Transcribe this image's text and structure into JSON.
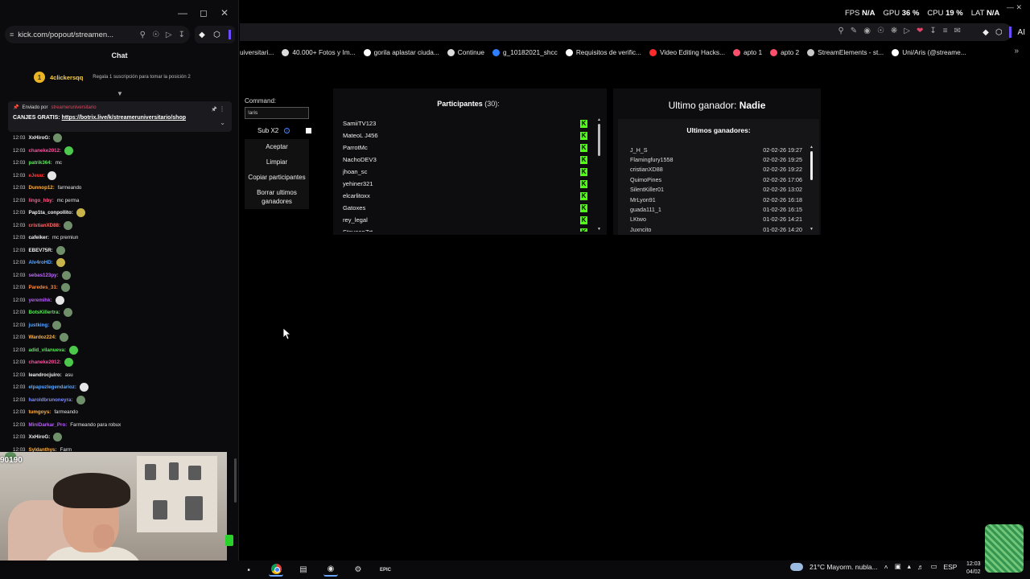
{
  "chat_window": {
    "url": "kick.com/popout/streamen...",
    "title": "Chat",
    "top_supporter": {
      "rank": "1",
      "name": "4clickersqq",
      "text": "Regala 1 suscripción para tomar la posición 2"
    },
    "pinned": {
      "sent_by_label": "Enviado por",
      "sender": "streameruniversitario",
      "text_label": "CANJES GRATIS:",
      "link": "https://botrix.live/k/streameruniversitario/shop"
    },
    "messages": [
      {
        "time": "12:03",
        "user": "XxHiroG:",
        "color": "#f2f2f2",
        "text": "",
        "emote": "frog"
      },
      {
        "time": "12:03",
        "user": "chaneke2012:",
        "color": "#ff4fa0",
        "text": "",
        "emote": "green"
      },
      {
        "time": "12:03",
        "user": "patrik364:",
        "color": "#5ce65c",
        "text": "mc",
        "emote": ""
      },
      {
        "time": "12:03",
        "user": "eJeuu:",
        "color": "#ff3b3b",
        "text": "",
        "emote": "white"
      },
      {
        "time": "12:03",
        "user": "Dunnop12:",
        "color": "#ffb347",
        "text": "farmeando",
        "emote": ""
      },
      {
        "time": "12:03",
        "user": "lingo_hby:",
        "color": "#ff5a8a",
        "text": "mc perma",
        "emote": ""
      },
      {
        "time": "12:03",
        "user": "Pap1ta_conpollito:",
        "color": "#f2f2f2",
        "text": "",
        "emote": "yellow"
      },
      {
        "time": "12:03",
        "user": "cristianXD88:",
        "color": "#ff6a6a",
        "text": "",
        "emote": "frog"
      },
      {
        "time": "12:03",
        "user": "cafeiker:",
        "color": "#f2f2f2",
        "text": "mc premiun",
        "emote": ""
      },
      {
        "time": "12:03",
        "user": "EBEV75R:",
        "color": "#f2f2f2",
        "text": "",
        "emote": "frog"
      },
      {
        "time": "12:03",
        "user": "Alv4roHD:",
        "color": "#5da8ff",
        "text": "",
        "emote": "yellow"
      },
      {
        "time": "12:03",
        "user": "sebas123py:",
        "color": "#c06bff",
        "text": "",
        "emote": "frog"
      },
      {
        "time": "12:03",
        "user": "Paredes_31:",
        "color": "#ff8a3d",
        "text": "",
        "emote": "frog"
      },
      {
        "time": "12:03",
        "user": "yeremihk:",
        "color": "#b95cff",
        "text": "",
        "emote": "white"
      },
      {
        "time": "12:03",
        "user": "BotsKillertra:",
        "color": "#5ce65c",
        "text": "",
        "emote": "frog"
      },
      {
        "time": "12:03",
        "user": "justking:",
        "color": "#5da8ff",
        "text": "",
        "emote": "frog"
      },
      {
        "time": "12:03",
        "user": "Wardoz224:",
        "color": "#ffb347",
        "text": "",
        "emote": "frog"
      },
      {
        "time": "12:03",
        "user": "adid_vilanueva:",
        "color": "#5ce65c",
        "text": "",
        "emote": "green"
      },
      {
        "time": "12:03",
        "user": "chaneke2012:",
        "color": "#ff4fa0",
        "text": "",
        "emote": "green"
      },
      {
        "time": "12:03",
        "user": "leandrocjuiro:",
        "color": "#f2f2f2",
        "text": "asu",
        "emote": ""
      },
      {
        "time": "12:03",
        "user": "elpapuzlegendarioz:",
        "color": "#5da8ff",
        "text": "",
        "emote": "white"
      },
      {
        "time": "12:03",
        "user": "haroldbrunoneyra:",
        "color": "#7b8cff",
        "text": "",
        "emote": "frog"
      },
      {
        "time": "12:03",
        "user": "tumgoys:",
        "color": "#ffb347",
        "text": "farmeando",
        "emote": ""
      },
      {
        "time": "12:03",
        "user": "MiniDarkar_Pro:",
        "color": "#b95cff",
        "text": "Farmeando para robux",
        "emote": ""
      },
      {
        "time": "12:03",
        "user": "XxHiroG:",
        "color": "#f2f2f2",
        "text": "",
        "emote": "frog"
      },
      {
        "time": "12:03",
        "user": "Syldanthys:",
        "color": "#ffb347",
        "text": "Farm",
        "emote": ""
      }
    ],
    "cam_badge": "90190"
  },
  "system_stats": {
    "fps_label": "FPS",
    "fps": "N/A",
    "gpu_label": "GPU",
    "gpu": "36 %",
    "cpu_label": "CPU",
    "cpu": "19 %",
    "lat_label": "LAT",
    "lat": "N/A"
  },
  "browser": {
    "url_fragment": "uiversitari...",
    "bookmarks": [
      {
        "label": "40.000+ Fotos y Im...",
        "color": "#dddddd"
      },
      {
        "label": "gorila aplastar ciuda...",
        "color": "#ffffff"
      },
      {
        "label": "Continue",
        "color": "#dddddd"
      },
      {
        "label": "g_10182021_shcc",
        "color": "#2f80ff"
      },
      {
        "label": "Requisitos de verific...",
        "color": "#ffffff"
      },
      {
        "label": "Video Editing Hacks...",
        "color": "#ff2b2b"
      },
      {
        "label": "apto 1",
        "color": "#ff4f6a"
      },
      {
        "label": "apto 2",
        "color": "#ff4f6a"
      },
      {
        "label": "StreamElements - st...",
        "color": "#c9c9c9"
      },
      {
        "label": "Uni/Aris (@streame...",
        "color": "#ffffff"
      }
    ]
  },
  "giveaway": {
    "command_label": "Command:",
    "command_value": "!aris",
    "sub_label": "Sub X2",
    "accept": "Aceptar",
    "clear": "Limpiar",
    "copy": "Copiar participantes",
    "delete_winners": "Borrar ultimos ganadores",
    "participants_label": "Participantes",
    "participants_count": "(30):",
    "participants": [
      "SamiiTV123",
      "MateoL J456",
      "ParrotMc",
      "NachoDEV3",
      "jhoan_sc",
      "yehiner321",
      "elcarlitoxx",
      "Gatoxes",
      "rey_legal",
      "SteveenZrt"
    ],
    "last_winner_label": "Ultimo ganador:",
    "last_winner": "Nadie",
    "recent_winners_label": "Ultimos ganadores:",
    "winners": [
      {
        "name": "J_H_S",
        "date": "02-02-26 19:27"
      },
      {
        "name": "Flamingfury1558",
        "date": "02-02-26 19:25"
      },
      {
        "name": "cristianXD88",
        "date": "02-02-26 19:22"
      },
      {
        "name": "QuimoPines",
        "date": "02-02-26 17:06"
      },
      {
        "name": "SilentKiller01",
        "date": "02-02-26 13:02"
      },
      {
        "name": "MrLyon91",
        "date": "02-02-26 16:18"
      },
      {
        "name": "guada111_1",
        "date": "01-02-26 16:15"
      },
      {
        "name": "LKtwo",
        "date": "01-02-26 14:21"
      },
      {
        "name": "Juxncito",
        "date": "01-02-26 14:20"
      }
    ]
  },
  "taskbar": {
    "weather": "21°C  Mayorm. nubla...",
    "lang": "ESP",
    "time": "12:03",
    "date": "04/02"
  }
}
